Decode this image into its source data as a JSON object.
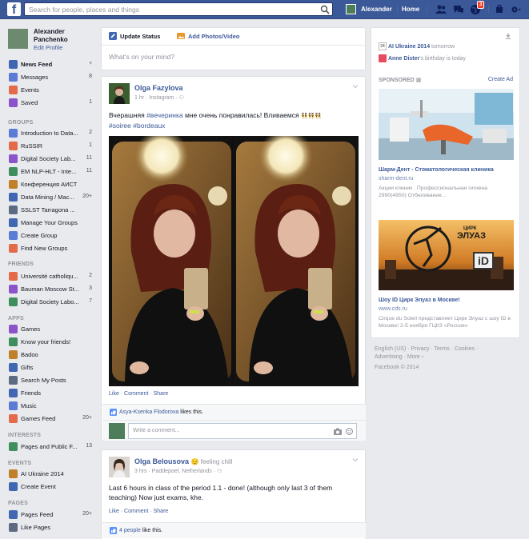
{
  "topbar": {
    "logo": "f",
    "search_placeholder": "Search for people, places and things",
    "user_name": "Alexander",
    "home": "Home",
    "notifications_count": "3"
  },
  "profile": {
    "name": "Alexander Panchenko",
    "edit": "Edit Profile"
  },
  "nav": {
    "main": [
      {
        "label": "News Feed",
        "count": "",
        "icon": "news-feed-icon"
      },
      {
        "label": "Messages",
        "count": "8",
        "icon": "messages-icon"
      },
      {
        "label": "Events",
        "count": "",
        "icon": "events-icon"
      },
      {
        "label": "Saved",
        "count": "1",
        "icon": "saved-icon"
      }
    ],
    "groups_header": "GROUPS",
    "groups": [
      {
        "label": "Introduction to Data...",
        "count": "2"
      },
      {
        "label": "RuSSIR",
        "count": "1"
      },
      {
        "label": "Digital Society Lab...",
        "count": "11"
      },
      {
        "label": "EM NLP-HLT - Inte...",
        "count": "11"
      },
      {
        "label": "Конференция АИСТ",
        "count": ""
      },
      {
        "label": "Data Mining / Mac...",
        "count": "20+"
      },
      {
        "label": "SSLST Tarragona ...",
        "count": ""
      },
      {
        "label": "Manage Your Groups",
        "count": ""
      },
      {
        "label": "Create Group",
        "count": ""
      },
      {
        "label": "Find New Groups",
        "count": ""
      }
    ],
    "friends_header": "FRIENDS",
    "friends": [
      {
        "label": "Université catholiqu...",
        "count": "2"
      },
      {
        "label": "Bauman Moscow St...",
        "count": "3"
      },
      {
        "label": "Digital Society Labo...",
        "count": "7"
      }
    ],
    "apps_header": "APPS",
    "apps": [
      {
        "label": "Games",
        "count": ""
      },
      {
        "label": "Know your friends!",
        "count": ""
      },
      {
        "label": "Badoo",
        "count": ""
      },
      {
        "label": "Gifts",
        "count": ""
      },
      {
        "label": "Search My Posts",
        "count": ""
      },
      {
        "label": "Friends",
        "count": ""
      },
      {
        "label": "Music",
        "count": ""
      },
      {
        "label": "Games Feed",
        "count": "20+"
      }
    ],
    "interests_header": "INTERESTS",
    "interests": [
      {
        "label": "Pages and Public F...",
        "count": "13"
      }
    ],
    "events_header": "EVENTS",
    "events": [
      {
        "label": "AI Ukraine 2014",
        "count": ""
      },
      {
        "label": "Create Event",
        "count": ""
      }
    ],
    "pages_header": "PAGES",
    "pages": [
      {
        "label": "Pages Feed",
        "count": "20+"
      },
      {
        "label": "Like Pages",
        "count": ""
      }
    ]
  },
  "composer": {
    "update_status": "Update Status",
    "add_photos": "Add Photos/Video",
    "placeholder": "What's on your mind?"
  },
  "post1": {
    "author": "Olga Fazylova",
    "meta": "1 hr · Instagram · ",
    "text_before": "Вчерашняя ",
    "hashtag1": "#вечеринка",
    "text_middle": " мне очень понравилась! Вливаемся ",
    "emoji": "👯👯👯",
    "hashtag2": "#soiree",
    "hashtag3": "#bordeaux",
    "actions": "Like · Comment · Share",
    "liker": "Asya-Ksenka Flodorova",
    "likes_suffix": " likes this.",
    "comment_placeholder": "Write a comment..."
  },
  "post2": {
    "author": "Olga Belousova",
    "feeling": "😔 feeling chill",
    "meta": "3 hrs · Paddepoel, Netherlands · ",
    "text": "Last 6 hours in class of the period 1.1 - done! (although only last 3 of them teaching) Now just exams, khe.",
    "actions": "Like · Comment · Share",
    "likes_link": "4 people",
    "likes_suffix": " like this."
  },
  "right": {
    "event_name": "AI Ukraine 2014",
    "event_when": " tomorrow",
    "event_date": "24",
    "birthday_name": "Anne Dister",
    "birthday_suffix": "'s birthday is today",
    "sponsored": "SPONSORED",
    "create_ad": "Create Ad",
    "ad1": {
      "title": "Шарм-Дент - Стоматологическая клиника",
      "url": "sharm-dent.ru",
      "desc": "Акции клиник : Профессиональная гигиена 2990(4950) Отбеливание..."
    },
    "ad2": {
      "title": "Шоу ID Цирк Элуаз в Москве!",
      "url": "www.cds.ru",
      "desc": "Cirque du Soleil представляет Цирк Элуаз с шоу ID в Москве! 2-5 ноября ГЦКЗ «Россия»",
      "banner_top": "ЦИРК",
      "banner_main": "ЭЛУАЗ",
      "banner_id": "iD"
    },
    "footer_line1": "English (US) · Privacy · Terms · Cookies ·",
    "footer_line2": "Advertising · More ›",
    "footer_line3": "Facebook © 2014"
  },
  "colors": {
    "brand": "#3b5998",
    "background": "#e9eaed",
    "badge": "#f03d25"
  }
}
